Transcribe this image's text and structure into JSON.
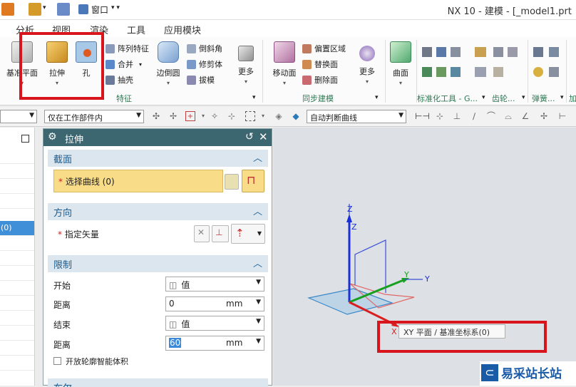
{
  "window": {
    "title": "NX 10 - 建模 - [_model1.prt"
  },
  "quick_access": {
    "window_menu": "窗口"
  },
  "menu_tabs": [
    "分析",
    "视图",
    "渲染",
    "工具",
    "应用模块"
  ],
  "ribbon": {
    "feature_group": {
      "label": "特征",
      "big_buttons": [
        "基准平面",
        "拉伸",
        "孔",
        "边倒圆",
        "更多"
      ],
      "small_buttons": [
        "阵列特征",
        "合并",
        "抽壳",
        "倒斜角",
        "修剪体",
        "拔模"
      ]
    },
    "sync_group": {
      "label": "同步建模",
      "big_buttons": [
        "移动面",
        "更多"
      ],
      "small_buttons": [
        "偏置区域",
        "替换面",
        "删除面"
      ]
    },
    "surface_group": {
      "big_button": "曲面"
    },
    "std_tools_group": {
      "label": "标准化工具 - G..."
    },
    "gear_group": {
      "label": "齿轮..."
    },
    "spring_group": {
      "label": "弹簧..."
    },
    "more_group": {
      "label": "加"
    }
  },
  "selection_bar": {
    "filter_scope": "仅在工作部件内",
    "curve_rule": "自动判断曲线"
  },
  "navigator": {
    "highlight_text": "(0)"
  },
  "dialog": {
    "title": "拉伸",
    "section": {
      "header": "截面",
      "select_curve": "选择曲线 (0)"
    },
    "direction": {
      "header": "方向",
      "specify_vector": "指定矢量"
    },
    "limits": {
      "header": "限制",
      "start_label": "开始",
      "start_option": "值",
      "start_distance_label": "距离",
      "start_distance": "0",
      "start_unit": "mm",
      "end_label": "结束",
      "end_option": "值",
      "end_distance_label": "距离",
      "end_distance": "60",
      "end_unit": "mm",
      "open_profile": "开放轮廓智能体积"
    },
    "next_section": "布尔"
  },
  "viewport": {
    "axis_z": "Z",
    "axis_y": "Y",
    "axis_x": "X",
    "tooltip": "XY 平面 / 基准坐标系(0)"
  },
  "watermark": {
    "text": "易采站长站"
  },
  "colors": {
    "highlight_red": "#d8141c",
    "dialog_header": "#3c6670",
    "section_bg": "#dbe6ee",
    "select_fill": "#f8dc88",
    "axis_blue": "#1a2fd8",
    "axis_green": "#18a020",
    "axis_red": "#d82020"
  }
}
